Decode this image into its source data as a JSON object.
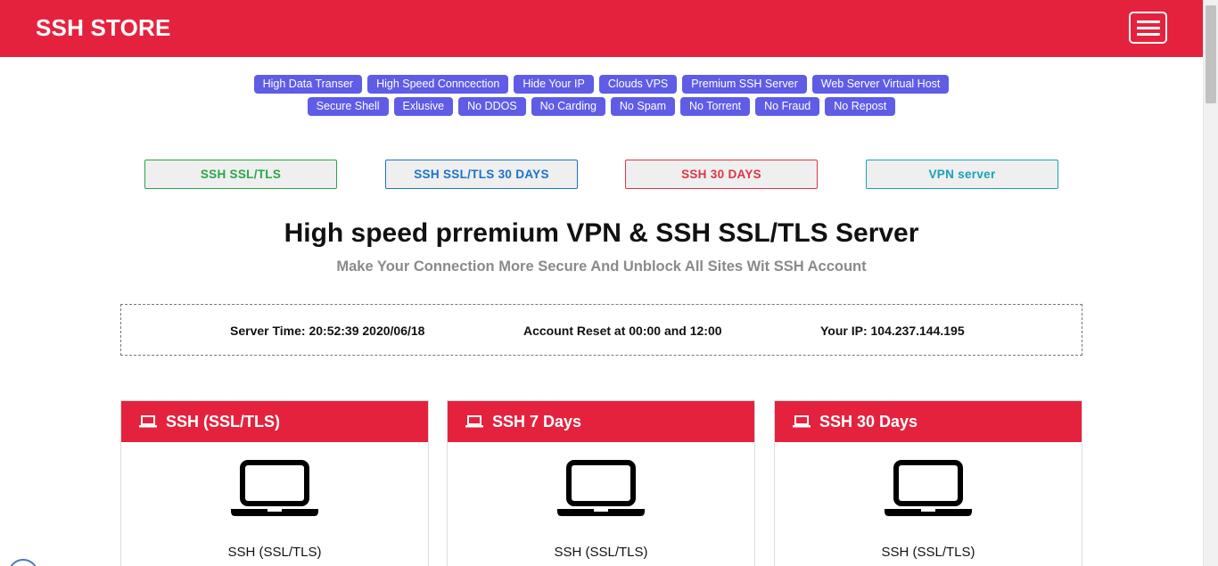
{
  "navbar": {
    "brand": "SSH STORE",
    "menu_icon": "hamburger-menu-icon",
    "bg_color": "#e5223d"
  },
  "tags": {
    "row1": [
      "High Data Transer",
      "High Speed Conncection",
      "Hide Your IP",
      "Clouds VPS",
      "Premium SSH Server",
      "Web Server Virtual Host"
    ],
    "row2": [
      "Secure Shell",
      "Exlusive",
      "No DDOS",
      "No Carding",
      "No Spam",
      "No Torrent",
      "No Fraud",
      "No Repost"
    ],
    "color": "#5f5ce6"
  },
  "nav_buttons": [
    {
      "label": "SSH SSL/TLS",
      "color": "#28a745"
    },
    {
      "label": "SSH SSL/TLS 30 DAYS",
      "color": "#1a73c9"
    },
    {
      "label": "SSH 30 DAYS",
      "color": "#dc3545"
    },
    {
      "label": "VPN server",
      "color": "#17a2b8"
    }
  ],
  "hero": {
    "title": "High speed prremium VPN & SSH SSL/TLS Server",
    "subtitle": "Make Your Connection More Secure And Unblock All Sites Wit SSH Account"
  },
  "info": {
    "server_time": "Server Time: 20:52:39 2020/06/18",
    "account_reset": "Account Reset at 00:00 and 12:00",
    "your_ip": "Your IP: 104.237.144.195"
  },
  "cards": [
    {
      "title": "SSH (SSL/TLS)",
      "label": "SSH (SSL/TLS)",
      "icon": "laptop-icon"
    },
    {
      "title": "SSH 7 Days",
      "label": "SSH (SSL/TLS)",
      "icon": "laptop-icon"
    },
    {
      "title": "SSH 30 Days",
      "label": "SSH (SSL/TLS)",
      "icon": "laptop-icon"
    }
  ]
}
